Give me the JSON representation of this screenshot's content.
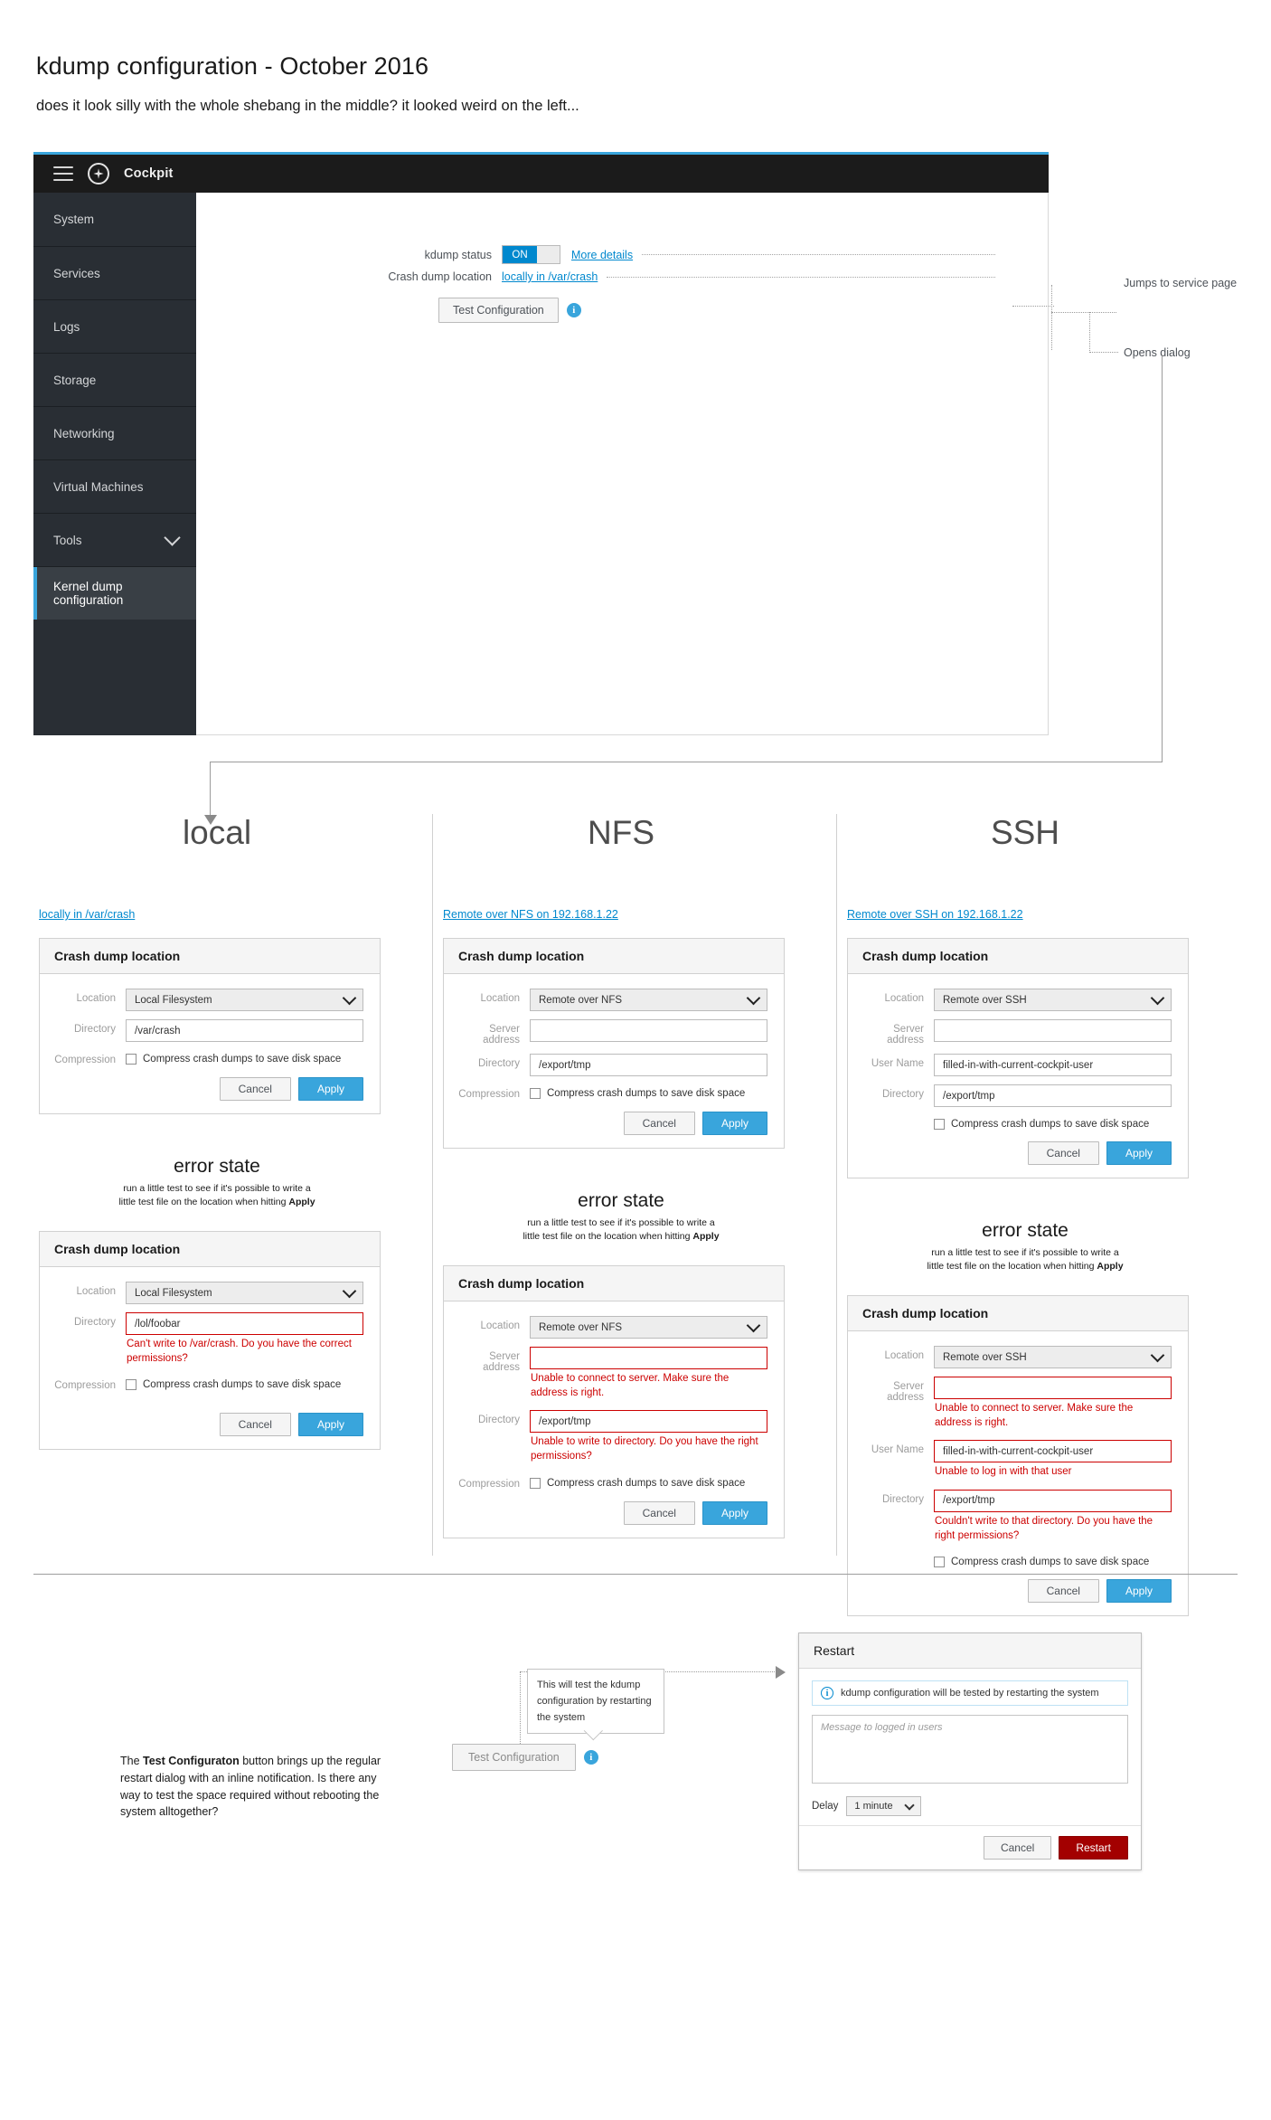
{
  "header": {
    "title": "kdump configuration - October 2016",
    "subtitle": "does it look silly with the whole shebang in the middle? it looked weird on the left..."
  },
  "cockpit": {
    "brand": "Cockpit",
    "sidebar": [
      {
        "label": "System",
        "active": false
      },
      {
        "label": "Services",
        "active": false
      },
      {
        "label": "Logs",
        "active": false
      },
      {
        "label": "Storage",
        "active": false
      },
      {
        "label": "Networking",
        "active": false
      },
      {
        "label": "Virtual Machines",
        "active": false
      },
      {
        "label": "Tools",
        "active": false,
        "chevron": true
      },
      {
        "label": "Kernel dump configuration",
        "active": true
      }
    ],
    "status_label": "kdump status",
    "toggle_on": "ON",
    "more_details": "More details",
    "location_label": "Crash dump location",
    "location_value": "locally in /var/crash",
    "test_button": "Test Configuration",
    "anno_service": "Jumps to service page",
    "anno_dialog": "Opens dialog"
  },
  "columns": [
    {
      "title": "local",
      "link": "locally in /var/crash",
      "card_title": "Crash dump location",
      "fields": [
        {
          "label": "Location",
          "type": "select",
          "value": "Local Filesystem"
        },
        {
          "label": "Directory",
          "type": "input",
          "value": "/var/crash"
        },
        {
          "label": "Compression",
          "type": "checkbox",
          "value": "Compress crash dumps to save disk space"
        }
      ],
      "cancel": "Cancel",
      "apply": "Apply",
      "error_title": "error state",
      "error_sub_1": "run a little test to see if it's possible to write a",
      "error_sub_2": "little test file on the location when hitting ",
      "error_sub_bold": "Apply",
      "error_fields": [
        {
          "label": "Location",
          "type": "select",
          "value": "Local Filesystem"
        },
        {
          "label": "Directory",
          "type": "input",
          "value": "/lol/foobar",
          "error": "Can't write to /var/crash. Do you have the correct permissions?"
        },
        {
          "label": "Compression",
          "type": "checkbox",
          "value": "Compress crash dumps to save disk space"
        }
      ]
    },
    {
      "title": "NFS",
      "link": "Remote over NFS on 192.168.1.22",
      "card_title": "Crash dump location",
      "fields": [
        {
          "label": "Location",
          "type": "select",
          "value": "Remote over NFS"
        },
        {
          "label": "Server address",
          "type": "input",
          "value": ""
        },
        {
          "label": "Directory",
          "type": "input",
          "value": "/export/tmp"
        },
        {
          "label": "Compression",
          "type": "checkbox",
          "value": "Compress crash dumps to save disk space"
        }
      ],
      "cancel": "Cancel",
      "apply": "Apply",
      "error_title": "error state",
      "error_sub_1": "run a little test to see if it's possible to write a",
      "error_sub_2": "little test file on the location when hitting ",
      "error_sub_bold": "Apply",
      "error_fields": [
        {
          "label": "Location",
          "type": "select",
          "value": "Remote over NFS"
        },
        {
          "label": "Server address",
          "type": "input",
          "value": "",
          "error": "Unable to connect to server. Make sure the address is right."
        },
        {
          "label": "Directory",
          "type": "input",
          "value": "/export/tmp",
          "error": "Unable to write to directory. Do you have the right permissions?"
        },
        {
          "label": "Compression",
          "type": "checkbox",
          "value": "Compress crash dumps to save disk space"
        }
      ]
    },
    {
      "title": "SSH",
      "link": "Remote over SSH on 192.168.1.22",
      "card_title": "Crash dump location",
      "fields": [
        {
          "label": "Location",
          "type": "select",
          "value": "Remote over SSH"
        },
        {
          "label": "Server address",
          "type": "input",
          "value": ""
        },
        {
          "label": "User Name",
          "type": "input",
          "value": "filled-in-with-current-cockpit-user"
        },
        {
          "label": "Directory",
          "type": "input",
          "value": "/export/tmp"
        },
        {
          "label": "Compression",
          "type": "checkbox",
          "value": "Compress crash dumps to save disk space"
        }
      ],
      "cancel": "Cancel",
      "apply": "Apply",
      "error_title": "error state",
      "error_sub_1": "run a little test to see if it's possible to write a",
      "error_sub_2": "little test file on the location when hitting ",
      "error_sub_bold": "Apply",
      "error_fields": [
        {
          "label": "Location",
          "type": "select",
          "value": "Remote over SSH"
        },
        {
          "label": "Server address",
          "type": "input",
          "value": "",
          "error": "Unable to connect to server. Make sure the address is right."
        },
        {
          "label": "User Name",
          "type": "input",
          "value": "filled-in-with-current-cockpit-user",
          "error": "Unable to log in with that user"
        },
        {
          "label": "Directory",
          "type": "input",
          "value": "/export/tmp",
          "error": "Couldn't write to that directory. Do you have the right permissions?"
        },
        {
          "label": "Compression",
          "type": "checkbox",
          "value": "Compress crash dumps to save disk space"
        }
      ]
    }
  ],
  "bottom": {
    "note_pre": "The ",
    "note_bold": "Test Configuraton",
    "note_post": " button brings up the regular restart dialog with an inline notification. Is there any way to test the space required without rebooting the system alltogether?",
    "tooltip": "This will test the kdump configuration by restarting the system",
    "test_button": "Test Configuration",
    "dialog": {
      "title": "Restart",
      "notification": "kdump configuration will be tested by restarting the system",
      "textarea_placeholder": "Message to logged in users",
      "delay_label": "Delay",
      "delay_value": "1 minute",
      "cancel": "Cancel",
      "restart": "Restart"
    }
  }
}
